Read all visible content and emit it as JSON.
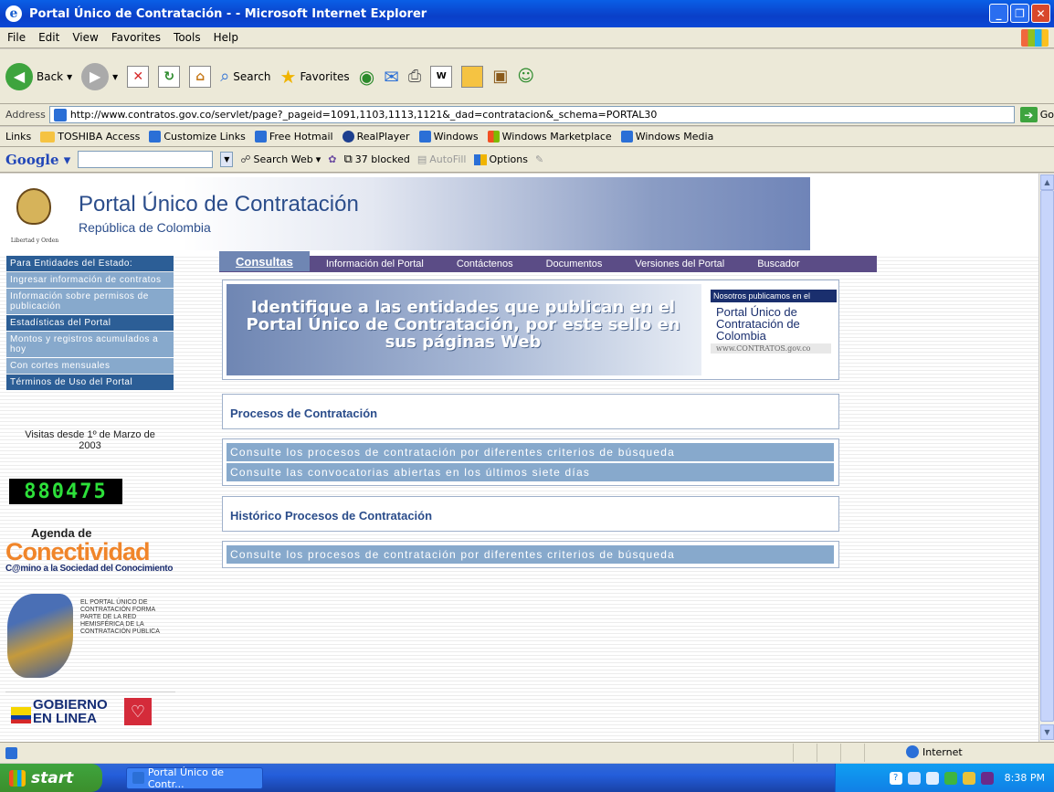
{
  "window": {
    "title": "Portal Único de Contratación - - Microsoft Internet Explorer",
    "min_label": "_",
    "max_label": "❐",
    "close_label": "✕"
  },
  "menubar": {
    "items": [
      "File",
      "Edit",
      "View",
      "Favorites",
      "Tools",
      "Help"
    ]
  },
  "toolbar": {
    "back_label": "Back",
    "search_label": "Search",
    "favorites_label": "Favorites"
  },
  "address": {
    "label": "Address",
    "url": "http://www.contratos.gov.co/servlet/page?_pageid=1091,1103,1113,1121&_dad=contratacion&_schema=PORTAL30",
    "go_label": "Go"
  },
  "links": {
    "label": "Links",
    "items": [
      "TOSHIBA Access",
      "Customize Links",
      "Free Hotmail",
      "RealPlayer",
      "Windows",
      "Windows Marketplace",
      "Windows Media"
    ]
  },
  "googlebar": {
    "logo": "Google",
    "search_web_label": "Search Web",
    "blocked_label": "37 blocked",
    "autofill_label": "AutoFill",
    "options_label": "Options"
  },
  "header": {
    "motto": "Libertad y Orden",
    "title": "Portal Único de Contratación",
    "subtitle": "República de Colombia"
  },
  "sidebar": {
    "items": [
      {
        "label": "Para Entidades del Estado:",
        "style": "dark"
      },
      {
        "label": "Ingresar información de contratos",
        "style": "light"
      },
      {
        "label": "Información sobre permisos de publicación",
        "style": "light"
      },
      {
        "label": "Estadísticas del Portal",
        "style": "dark"
      },
      {
        "label": "Montos y registros acumulados a hoy",
        "style": "light"
      },
      {
        "label": "Con cortes mensuales",
        "style": "light"
      },
      {
        "label": "Términos de Uso del Portal",
        "style": "dark"
      }
    ],
    "visits_label": "Visitas desde 1º de Marzo de 2003",
    "counter": "880475"
  },
  "logos": {
    "agenda_top": "Agenda de",
    "agenda_big": "Conectividad",
    "agenda_sub": "C@mino a la Sociedad del Conocimiento",
    "red_text": "EL PORTAL ÚNICO DE CONTRATACIÓN FORMA PARTE DE LA RED HEMISFÉRICA DE LA CONTRATACIÓN PÚBLICA",
    "gob_line1": "GOBIERNO",
    "gob_line2": "EN LINEA"
  },
  "navtabs": [
    {
      "label": "Consultas",
      "active": true
    },
    {
      "label": "Información del Portal",
      "active": false
    },
    {
      "label": "Contáctenos",
      "active": false
    },
    {
      "label": "Documentos",
      "active": false
    },
    {
      "label": "Versiones del Portal",
      "active": false
    },
    {
      "label": "Buscador",
      "active": false
    }
  ],
  "banner": {
    "text": "Identifique a las entidades que publican en el Portal Único de Contratación, por este sello en sus páginas Web",
    "seal_top": "Nosotros publicamos en el",
    "seal_body": "Portal Único de Contratación de Colombia",
    "seal_url": "www.CONTRATOS.gov.co"
  },
  "sections": {
    "procesos_title": "Procesos de Contratación",
    "procesos_links": [
      "Consulte los procesos de contratación por diferentes criterios de búsqueda",
      "Consulte las convocatorias abiertas en los últimos siete días"
    ],
    "historico_title": "Histórico Procesos de Contratación",
    "historico_links": [
      "Consulte los procesos de contratación por diferentes criterios de búsqueda"
    ]
  },
  "status": {
    "zone": "Internet"
  },
  "taskbar": {
    "start_label": "start",
    "task_label": "Portal Único de Contr...",
    "clock": "8:38 PM"
  },
  "colors": {
    "sidebar_dark": "#2c5e96",
    "sidebar_light": "#87a9cc",
    "nav_bg": "#5b4c86",
    "heading_blue": "#2b4d8b"
  }
}
